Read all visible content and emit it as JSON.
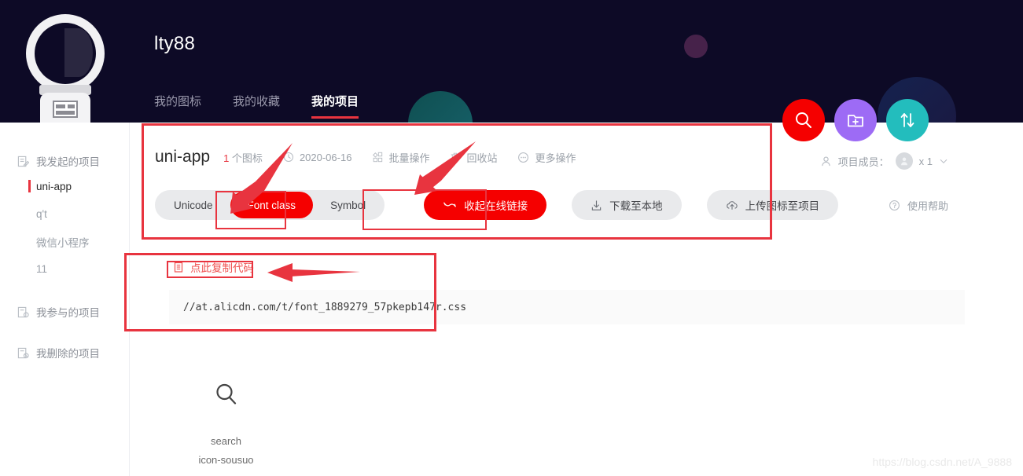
{
  "header": {
    "username": "lty88",
    "logo_icon": "astronaut-helmet-logo",
    "tabs": [
      {
        "label": "我的图标",
        "active": false
      },
      {
        "label": "我的收藏",
        "active": false
      },
      {
        "label": "我的项目",
        "active": true
      }
    ]
  },
  "fabs": [
    {
      "name": "search-fab",
      "icon": "search-icon",
      "color": "#f50000"
    },
    {
      "name": "new-folder-fab",
      "icon": "folder-plus-icon",
      "color": "#9d6bf5"
    },
    {
      "name": "sort-fab",
      "icon": "sort-arrows-icon",
      "color": "#23bdbd"
    }
  ],
  "sidebar": {
    "groups": [
      {
        "label": "我发起的项目",
        "icon": "project-edit-icon"
      },
      {
        "label": "我参与的项目",
        "icon": "project-member-icon"
      },
      {
        "label": "我删除的项目",
        "icon": "project-delete-icon"
      }
    ],
    "projects": [
      {
        "label": "uni-app",
        "active": true
      },
      {
        "label": "q't",
        "active": false
      },
      {
        "label": "微信小程序",
        "active": false
      },
      {
        "label": "11",
        "active": false
      }
    ]
  },
  "project": {
    "name": "uni-app",
    "icon_count": "1",
    "icon_count_unit": "个图标",
    "date": "2020-06-16",
    "date_icon": "clock-icon",
    "actions": [
      {
        "label": "批量操作",
        "icon": "batch-icon"
      },
      {
        "label": "回收站",
        "icon": "trash-icon"
      },
      {
        "label": "更多操作",
        "icon": "ellipsis-icon"
      }
    ],
    "members_label": "项目成员：",
    "members_count": "x 1",
    "members_avatar": "avatar",
    "members_chevron": "chevron-down-icon",
    "help_label": "使用帮助",
    "help_icon": "question-circle-icon"
  },
  "toolbar": {
    "segments": [
      {
        "label": "Unicode",
        "active": false
      },
      {
        "label": "Font class",
        "active": true
      },
      {
        "label": "Symbol",
        "active": false
      }
    ],
    "collapse_link_label": "收起在线链接",
    "collapse_link_icon": "collapse-icon",
    "download_label": "下载至本地",
    "download_icon": "download-icon",
    "upload_label": "上传图标至项目",
    "upload_icon": "upload-cloud-icon"
  },
  "code_panel": {
    "copy_label": "点此复制代码",
    "copy_icon": "copy-icon",
    "css_url": "//at.alicdn.com/t/font_1889279_57pkepb147r.css"
  },
  "icons": [
    {
      "glyph": "search-glyph",
      "name": "search",
      "class_name": "icon-sousuo"
    }
  ],
  "watermark": "https://blog.csdn.net/A_9888",
  "colors": {
    "header_bg": "#0d0a26",
    "accent_red": "#f50000",
    "annotation_red": "#e8343f",
    "purple": "#9d6bf5",
    "teal": "#23bdbd"
  }
}
